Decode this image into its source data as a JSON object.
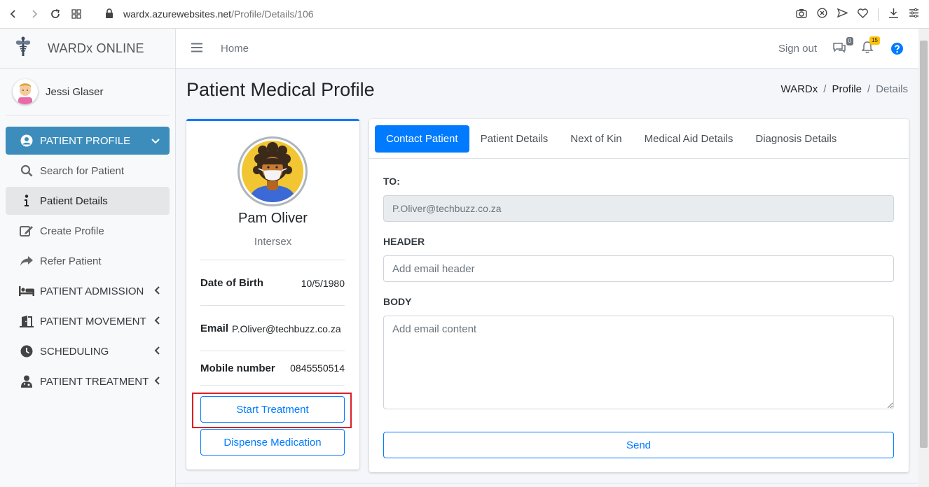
{
  "browser": {
    "url_host": "wardx.azurewebsites.net",
    "url_path": "/Profile/Details/106",
    "icons": [
      "back-icon",
      "forward-icon",
      "reload-icon",
      "tabs-grid-icon",
      "lock-icon",
      "camera-icon",
      "adblock-icon",
      "send-icon",
      "heart-icon",
      "download-icon",
      "menu-icon"
    ]
  },
  "brand": {
    "name": "WARDx ONLINE"
  },
  "user": {
    "name": "Jessi Glaser"
  },
  "sidebar": {
    "items": [
      {
        "label": "PATIENT PROFILE",
        "icon": "user-circle-icon"
      },
      {
        "label": "Search for Patient",
        "icon": "search-icon"
      },
      {
        "label": "Patient Details",
        "icon": "info-icon"
      },
      {
        "label": "Create Profile",
        "icon": "edit-icon"
      },
      {
        "label": "Refer Patient",
        "icon": "share-icon"
      },
      {
        "label": "PATIENT ADMISSION",
        "icon": "bed-icon"
      },
      {
        "label": "PATIENT MOVEMENT",
        "icon": "door-icon"
      },
      {
        "label": "SCHEDULING",
        "icon": "clock-icon"
      },
      {
        "label": "PATIENT TREATMENT",
        "icon": "doctor-icon"
      }
    ]
  },
  "topbar": {
    "home": "Home",
    "signout": "Sign out",
    "messages_count": "0",
    "notifications_count": "15"
  },
  "page": {
    "title": "Patient Medical Profile",
    "breadcrumb": [
      "WARDx",
      "Profile",
      "Details"
    ]
  },
  "profile": {
    "name": "Pam Oliver",
    "gender": "Intersex",
    "dob_label": "Date of Birth",
    "dob": "10/5/1980",
    "email_label": "Email",
    "email": "P.Oliver@techbuzz.co.za",
    "mobile_label": "Mobile number",
    "mobile": "0845550514",
    "start_treatment": "Start Treatment",
    "dispense_medication": "Dispense Medication"
  },
  "tabs": [
    "Contact Patient",
    "Patient Details",
    "Next of Kin",
    "Medical Aid Details",
    "Diagnosis Details"
  ],
  "contact_form": {
    "to_label": "TO:",
    "to_value": "P.Oliver@techbuzz.co.za",
    "header_label": "HEADER",
    "header_placeholder": "Add email header",
    "body_label": "BODY",
    "body_placeholder": "Add email content",
    "send": "Send"
  },
  "colors": {
    "primary": "#007bff",
    "sidebar_active": "#3c8dbc",
    "highlight": "#dc1f26"
  }
}
